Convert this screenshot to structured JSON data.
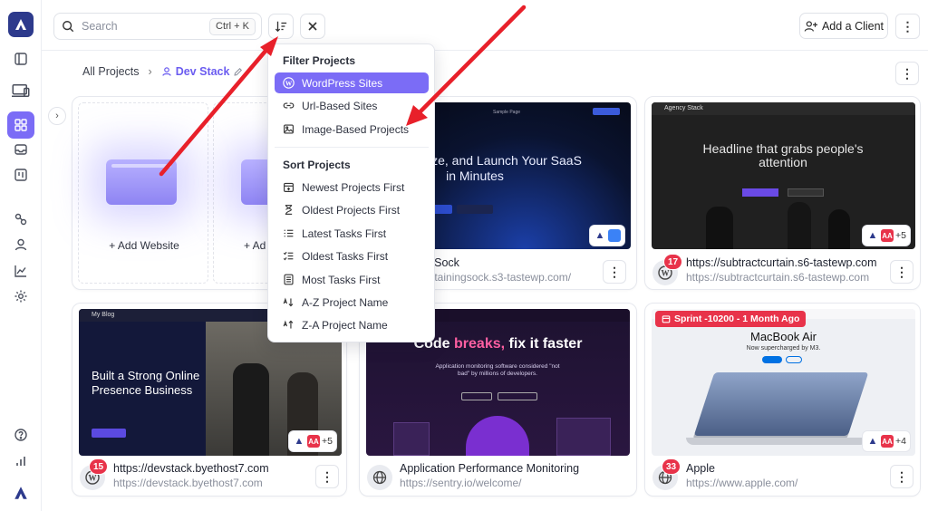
{
  "search": {
    "placeholder": "Search",
    "shortcut": "Ctrl + K"
  },
  "header": {
    "add_client_label": "Add a Client"
  },
  "breadcrumb": {
    "root": "All Projects",
    "current": "Dev Stack"
  },
  "placeholder_cards": [
    {
      "label": "+ Add Website"
    },
    {
      "label": "+ Ad"
    }
  ],
  "dropdown": {
    "filter_heading": "Filter Projects",
    "filter_items": [
      {
        "label": "WordPress Sites",
        "icon": "wordpress-icon",
        "selected": true
      },
      {
        "label": "Url-Based Sites",
        "icon": "link-icon",
        "selected": false
      },
      {
        "label": "Image-Based Projects",
        "icon": "image-icon",
        "selected": false
      }
    ],
    "sort_heading": "Sort Projects",
    "sort_items": [
      {
        "label": "Newest Projects First",
        "icon": "calendar-plus-icon"
      },
      {
        "label": "Oldest Projects First",
        "icon": "hourglass-icon"
      },
      {
        "label": "Latest Tasks First",
        "icon": "list-icon"
      },
      {
        "label": "Oldest Tasks First",
        "icon": "list-check-icon"
      },
      {
        "label": "Most Tasks First",
        "icon": "document-list-icon"
      },
      {
        "label": "A-Z Project Name",
        "icon": "sort-az-icon"
      },
      {
        "label": "Z-A Project Name",
        "icon": "sort-za-icon"
      }
    ]
  },
  "projects": [
    {
      "title": "ning Sock",
      "url": "entertainingsock.s3-tastewp.com/",
      "screenshot_headline": "ld, Customize, and Launch Your SaaS in Minutes",
      "screenshot_nav": "Sample Page",
      "avatars_extra": "",
      "badge": ""
    },
    {
      "title": "https://subtractcurtain.s6-tastewp.com",
      "url": "https://subtractcurtain.s6-tastewp.com",
      "screenshot_brand": "Agency Stack",
      "screenshot_headline": "Headline that grabs people's attention",
      "avatars_extra": "+5",
      "badge": "17"
    },
    {
      "title": "https://devstack.byethost7.com",
      "url": "https://devstack.byethost7.com",
      "screenshot_brand": "My Blog",
      "screenshot_headline": "Built a Strong Online Presence Business",
      "avatars_extra": "+5",
      "badge": "15"
    },
    {
      "title": "Application Performance Monitoring",
      "url": "https://sentry.io/welcome/",
      "screenshot_headline_a": "Code ",
      "screenshot_headline_b": "breaks,",
      "screenshot_headline_c": " fix it faster",
      "screenshot_sub": "Application monitoring software considered \"not bad\" by millions of developers.",
      "avatars_extra": "",
      "badge": ""
    },
    {
      "title": "Apple",
      "url": "https://www.apple.com/",
      "screenshot_headline": "MacBook Air",
      "screenshot_sub": "Now supercharged by M3.",
      "sprint_label": "Sprint -10200 - 1 Month Ago",
      "avatars_extra": "+4",
      "badge": "33"
    }
  ],
  "colors": {
    "accent": "#7b6cf6",
    "badge": "#e8334a",
    "arrow": "#e8202a"
  }
}
